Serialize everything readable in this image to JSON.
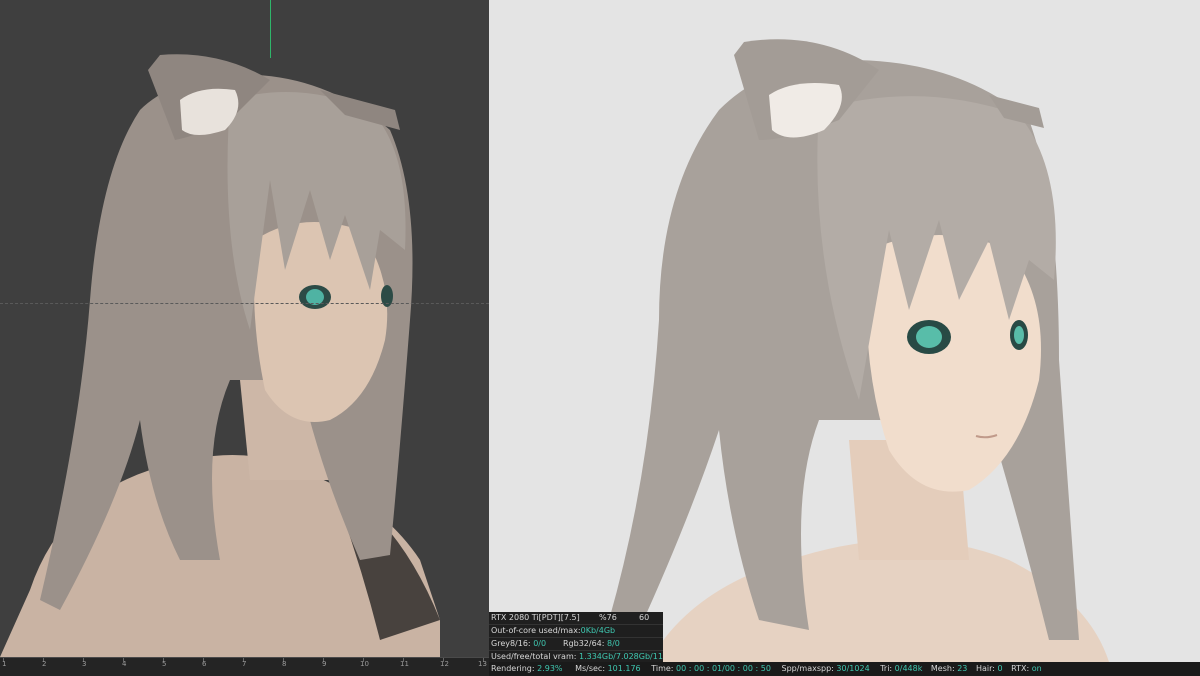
{
  "timeline": {
    "ticks": [
      "1",
      "2",
      "3",
      "4",
      "5",
      "6",
      "7",
      "8",
      "9",
      "10",
      "11",
      "12",
      "13"
    ]
  },
  "stats": {
    "gpu": "RTX 2080 Ti[PDT][7.5]",
    "percent": "%76",
    "value": "60",
    "out_of_core_label": "Out-of-core used/max:",
    "out_of_core_value": "0Kb/4Gb",
    "grey_label": "Grey8/16:",
    "grey_value": "0/0",
    "rgb_label": "Rgb32/64:",
    "rgb_value": "8/0",
    "vram_label": "Used/free/total vram:",
    "vram_value": "1.334Gb/7.028Gb/11Gb"
  },
  "status": {
    "rendering_label": "Rendering:",
    "rendering_value": "2.93%",
    "ms_label": "Ms/sec:",
    "ms_value": "101.176",
    "time_label": "Time:",
    "time_value": "00 : 00 : 01/00 : 00 : 50",
    "spp_label": "Spp/maxspp:",
    "spp_value": "30/1024",
    "tri_label": "Tri:",
    "tri_value": "0/448k",
    "mesh_label": "Mesh:",
    "mesh_value": "23",
    "hair_label": "Hair:",
    "hair_value": "0",
    "rtx_label": "RTX:",
    "rtx_value": "on"
  }
}
